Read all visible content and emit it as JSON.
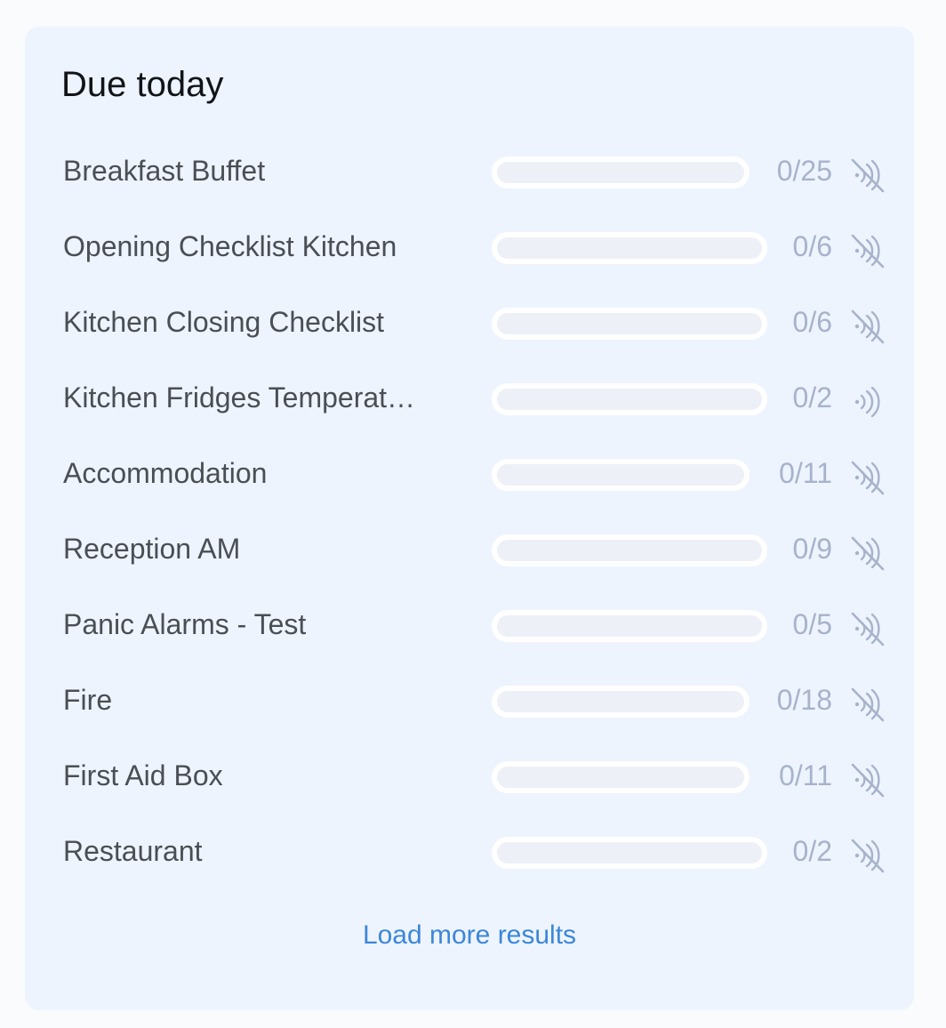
{
  "card": {
    "title": "Due today",
    "load_more_label": "Load more results"
  },
  "checklists": [
    {
      "name": "Breakfast Buffet",
      "count": "0/25",
      "completed": 0,
      "total": 25,
      "nfc_icon": "nfc-disabled-icon"
    },
    {
      "name": "Opening Checklist Kitchen",
      "count": "0/6",
      "completed": 0,
      "total": 6,
      "nfc_icon": "nfc-disabled-icon"
    },
    {
      "name": "Kitchen Closing Checklist",
      "count": "0/6",
      "completed": 0,
      "total": 6,
      "nfc_icon": "nfc-disabled-icon"
    },
    {
      "name": "Kitchen Fridges Temperat…",
      "count": "0/2",
      "completed": 0,
      "total": 2,
      "nfc_icon": "nfc-enabled-icon"
    },
    {
      "name": "Accommodation",
      "count": "0/11",
      "completed": 0,
      "total": 11,
      "nfc_icon": "nfc-disabled-icon"
    },
    {
      "name": "Reception AM",
      "count": "0/9",
      "completed": 0,
      "total": 9,
      "nfc_icon": "nfc-disabled-icon"
    },
    {
      "name": "Panic Alarms - Test",
      "count": "0/5",
      "completed": 0,
      "total": 5,
      "nfc_icon": "nfc-disabled-icon"
    },
    {
      "name": "Fire",
      "count": "0/18",
      "completed": 0,
      "total": 18,
      "nfc_icon": "nfc-disabled-icon"
    },
    {
      "name": "First Aid Box",
      "count": "0/11",
      "completed": 0,
      "total": 11,
      "nfc_icon": "nfc-disabled-icon"
    },
    {
      "name": "Restaurant",
      "count": "0/2",
      "completed": 0,
      "total": 2,
      "nfc_icon": "nfc-disabled-icon"
    }
  ],
  "colors": {
    "card_background": "#eef4fd",
    "progress_track": "#eef0f7",
    "progress_fill": "#4c8be0",
    "count_text": "#a7b3cc",
    "icon": "#a7b3cc",
    "link": "#3b87d9"
  }
}
